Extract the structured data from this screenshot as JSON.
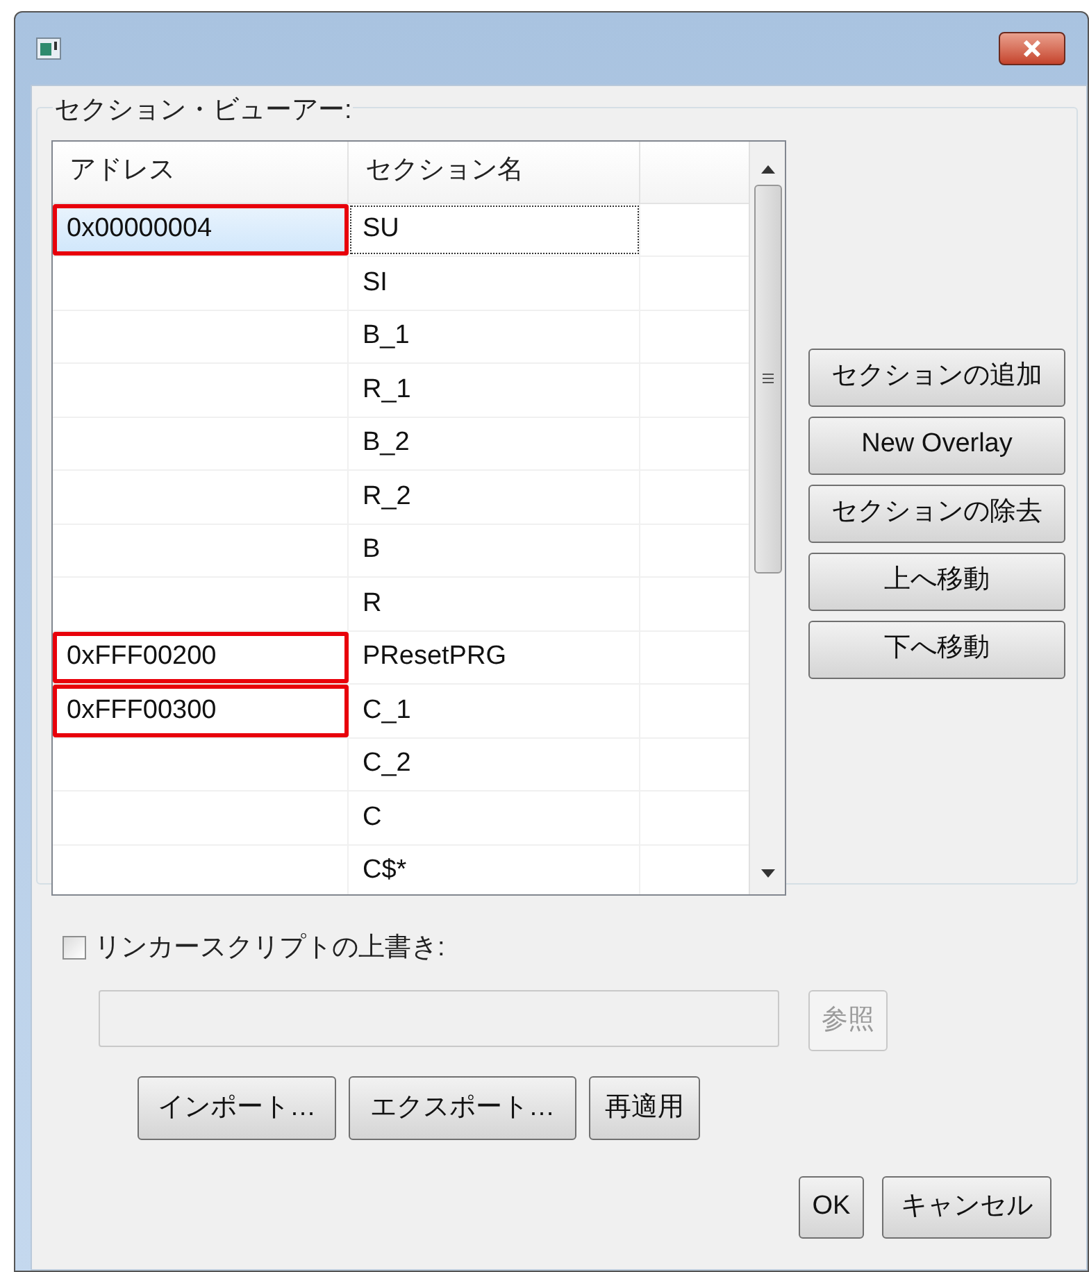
{
  "group_label": "セクション・ビューアー:",
  "table": {
    "columns": [
      "アドレス",
      "セクション名"
    ],
    "rows": [
      {
        "address": "0x00000004",
        "name": "SU",
        "selected": true,
        "highlighted": true
      },
      {
        "name": "SI",
        "selected": false,
        "highlighted": false
      },
      {
        "name": "B_1",
        "selected": false,
        "highlighted": false
      },
      {
        "name": "R_1",
        "selected": false,
        "highlighted": false
      },
      {
        "name": "B_2",
        "selected": false,
        "highlighted": false
      },
      {
        "name": "R_2",
        "selected": false,
        "highlighted": false
      },
      {
        "name": "B",
        "selected": false,
        "highlighted": false
      },
      {
        "name": "R",
        "selected": false,
        "highlighted": false
      },
      {
        "address": "0xFFF00200",
        "name": "PResetPRG",
        "selected": false,
        "highlighted": true
      },
      {
        "address": "0xFFF00300",
        "name": "C_1",
        "selected": false,
        "highlighted": true
      },
      {
        "name": "C_2",
        "selected": false,
        "highlighted": false
      },
      {
        "name": "C",
        "selected": false,
        "highlighted": false
      },
      {
        "name": "C$*",
        "selected": false,
        "highlighted": false
      }
    ]
  },
  "side_buttons": [
    "セクションの追加",
    "New Overlay",
    "セクションの除去",
    "上へ移動",
    "下へ移動"
  ],
  "override": {
    "label": "リンカースクリプトの上書き:",
    "checked": false,
    "browse": "参照",
    "browse_disabled": true
  },
  "action_buttons": [
    "インポート…",
    "エクスポート…",
    "再適用"
  ],
  "dialog_buttons": [
    "OK",
    "キャンセル"
  ]
}
